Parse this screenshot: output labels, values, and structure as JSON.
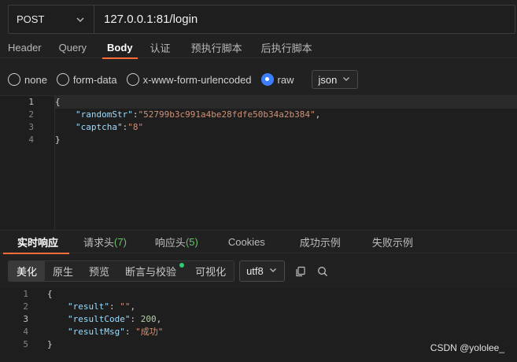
{
  "request": {
    "method": "POST",
    "url": "127.0.0.1:81/login"
  },
  "top_tabs": [
    {
      "label": "Header"
    },
    {
      "label": "Query"
    },
    {
      "label": "Body"
    },
    {
      "label": "认证"
    },
    {
      "label": "预执行脚本"
    },
    {
      "label": "后执行脚本"
    }
  ],
  "active_top_tab": "Body",
  "body_types": [
    {
      "label": "none"
    },
    {
      "label": "form-data"
    },
    {
      "label": "x-www-form-urlencoded"
    },
    {
      "label": "raw"
    }
  ],
  "selected_body_type": "raw",
  "format_select": "json",
  "request_body": {
    "line_numbers": [
      "1",
      "2",
      "3",
      "4"
    ],
    "open_brace": "{",
    "key1": "\"randomStr\"",
    "val1": "\"52799b3c991a4be28fdfe50b34a2b384\"",
    "key2": "\"captcha\"",
    "val2": "\"8\"",
    "close_brace": "}"
  },
  "response_tabs": [
    {
      "label": "实时响应"
    },
    {
      "label": "请求头",
      "count": "(7)"
    },
    {
      "label": "响应头",
      "count": "(5)"
    },
    {
      "label": "Cookies"
    },
    {
      "label": "成功示例"
    },
    {
      "label": "失败示例"
    }
  ],
  "active_response_tab": "实时响应",
  "view_modes": [
    {
      "label": "美化"
    },
    {
      "label": "原生"
    },
    {
      "label": "预览"
    },
    {
      "label": "断言与校验"
    },
    {
      "label": "可视化"
    }
  ],
  "active_view_mode": "美化",
  "encoding": "utf8",
  "response_body": {
    "line_numbers": [
      "1",
      "2",
      "3",
      "4",
      "5"
    ],
    "open_brace": "{",
    "key1": "\"result\"",
    "val1": "\"\"",
    "key2": "\"resultCode\"",
    "val2": "200",
    "key3": "\"resultMsg\"",
    "val3": "\"成功\"",
    "close_brace": "}"
  },
  "watermark": "CSDN @yololee_",
  "colors": {
    "accent": "#ff6c37",
    "radio_selected": "#3d7eff",
    "count_green": "#6cc06c",
    "json_key": "#9cdcfe",
    "json_string": "#ce9178",
    "json_number": "#b5cea8"
  },
  "icons": [
    "chevron-down-icon",
    "copy-icon",
    "search-icon"
  ]
}
